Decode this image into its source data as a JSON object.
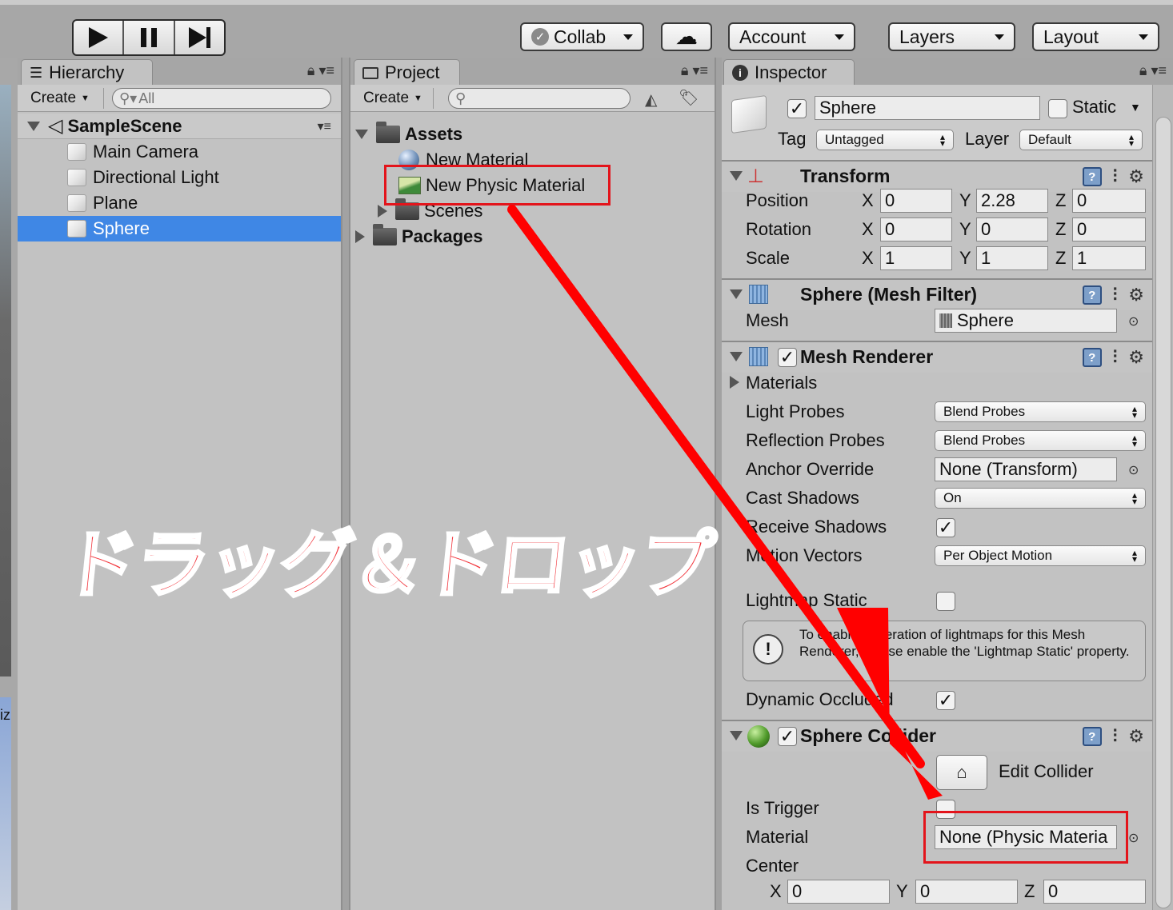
{
  "toolbar": {
    "collab_label": "Collab",
    "account_label": "Account",
    "layers_label": "Layers",
    "layout_label": "Layout"
  },
  "left_edge": {
    "partial_label": "iz"
  },
  "hierarchy": {
    "tab_label": "Hierarchy",
    "create_label": "Create",
    "search_placeholder": "All",
    "scene_name": "SampleScene",
    "items": [
      {
        "label": "Main Camera"
      },
      {
        "label": "Directional Light"
      },
      {
        "label": "Plane"
      },
      {
        "label": "Sphere"
      }
    ],
    "selected_item": "Sphere"
  },
  "project": {
    "tab_label": "Project",
    "create_label": "Create",
    "assets_label": "Assets",
    "items": [
      {
        "label": "New Material",
        "icon": "material-sphere-icon"
      },
      {
        "label": "New Physic Material",
        "icon": "physic-material-icon"
      },
      {
        "label": "Scenes",
        "icon": "folder-icon"
      }
    ],
    "packages_label": "Packages"
  },
  "inspector": {
    "tab_label": "Inspector",
    "object_name": "Sphere",
    "static_label": "Static",
    "tag_label": "Tag",
    "tag_value": "Untagged",
    "layer_label": "Layer",
    "layer_value": "Default",
    "transform": {
      "title": "Transform",
      "position_label": "Position",
      "rotation_label": "Rotation",
      "scale_label": "Scale",
      "axis_x": "X",
      "axis_y": "Y",
      "axis_z": "Z",
      "position": {
        "x": "0",
        "y": "2.28",
        "z": "0"
      },
      "rotation": {
        "x": "0",
        "y": "0",
        "z": "0"
      },
      "scale": {
        "x": "1",
        "y": "1",
        "z": "1"
      }
    },
    "mesh_filter": {
      "title": "Sphere (Mesh Filter)",
      "mesh_label": "Mesh",
      "mesh_value": "Sphere"
    },
    "mesh_renderer": {
      "title": "Mesh Renderer",
      "materials_label": "Materials",
      "light_probes_label": "Light Probes",
      "light_probes_value": "Blend Probes",
      "reflection_probes_label": "Reflection Probes",
      "reflection_probes_value": "Blend Probes",
      "anchor_override_label": "Anchor Override",
      "anchor_override_value": "None (Transform)",
      "cast_shadows_label": "Cast Shadows",
      "cast_shadows_value": "On",
      "receive_shadows_label": "Receive Shadows",
      "receive_shadows_checked": true,
      "motion_vectors_label": "Motion Vectors",
      "motion_vectors_value": "Per Object Motion",
      "lightmap_static_label": "Lightmap Static",
      "lightmap_static_checked": false,
      "info_text": "To enable generation of lightmaps for this Mesh Renderer, please enable the 'Lightmap Static' property.",
      "dynamic_occluded_label": "Dynamic Occluded",
      "dynamic_occluded_checked": true
    },
    "sphere_collider": {
      "title": "Sphere Collider",
      "edit_collider_label": "Edit Collider",
      "is_trigger_label": "Is Trigger",
      "is_trigger_checked": false,
      "material_label": "Material",
      "material_value": "None (Physic Materia",
      "center_label": "Center",
      "center": {
        "x": "0",
        "y": "0",
        "z": "0"
      }
    }
  },
  "annotation": {
    "text": "ドラッグ＆ドロップ",
    "color": "#f2353c",
    "arrow_color": "#ff0000",
    "highlight_color": "#e3141b"
  }
}
